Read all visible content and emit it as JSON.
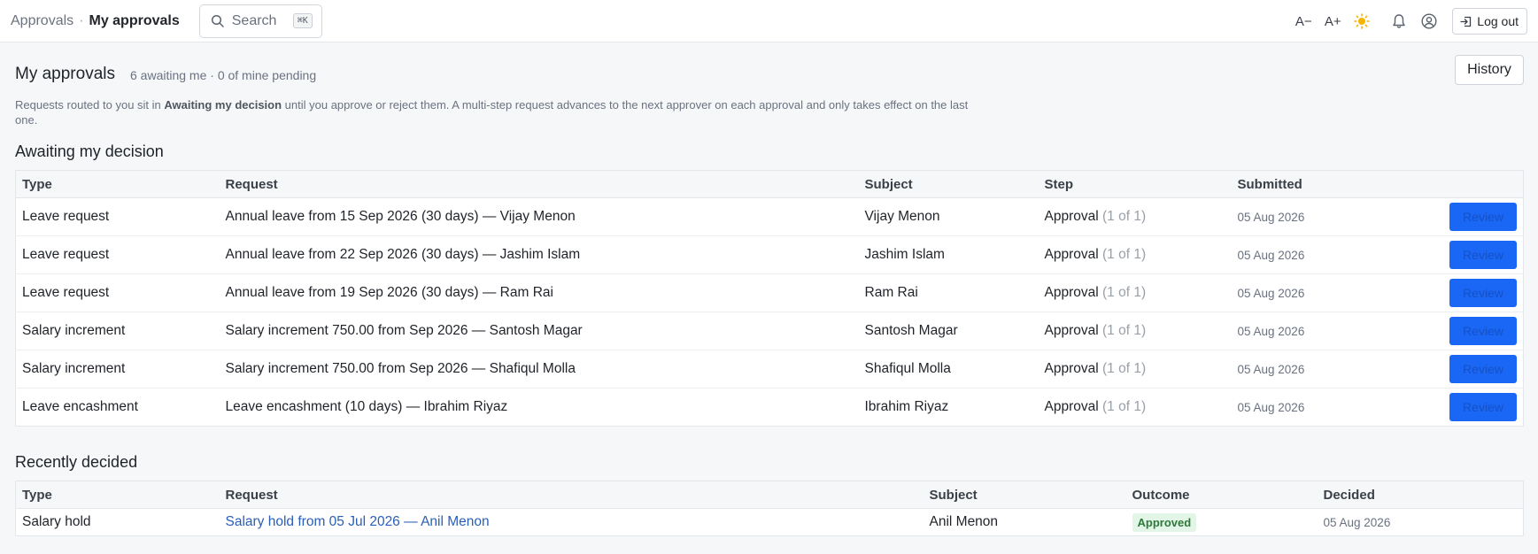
{
  "breadcrumb": {
    "parent": "Approvals",
    "separator": "·",
    "current": "My approvals"
  },
  "search": {
    "label": "Search",
    "shortcut": "⌘K"
  },
  "toolbar": {
    "font_decrease": "A−",
    "font_increase": "A+",
    "logout_label": "Log out"
  },
  "page": {
    "title": "My approvals",
    "subtitle": "6 awaiting me · 0 of mine pending",
    "history_label": "History",
    "desc_before": "Requests routed to you sit in ",
    "desc_bold": "Awaiting my decision",
    "desc_after": " until you approve or reject them. A multi-step request advances to the next approver on each approval and only takes effect on the last one."
  },
  "awaiting": {
    "title": "Awaiting my decision",
    "columns": [
      "Type",
      "Request",
      "Subject",
      "Step",
      "Submitted"
    ],
    "review_label": "Review",
    "rows": [
      {
        "type": "Leave request",
        "request": "Annual leave from 15 Sep 2026 (30 days) — Vijay Menon",
        "subject": "Vijay Menon",
        "step": "Approval",
        "step_count": "(1 of 1)",
        "submitted": "05 Aug 2026"
      },
      {
        "type": "Leave request",
        "request": "Annual leave from 22 Sep 2026 (30 days) — Jashim Islam",
        "subject": "Jashim Islam",
        "step": "Approval",
        "step_count": "(1 of 1)",
        "submitted": "05 Aug 2026"
      },
      {
        "type": "Leave request",
        "request": "Annual leave from 19 Sep 2026 (30 days) — Ram Rai",
        "subject": "Ram Rai",
        "step": "Approval",
        "step_count": "(1 of 1)",
        "submitted": "05 Aug 2026"
      },
      {
        "type": "Salary increment",
        "request": "Salary increment 750.00 from Sep 2026 — Santosh Magar",
        "subject": "Santosh Magar",
        "step": "Approval",
        "step_count": "(1 of 1)",
        "submitted": "05 Aug 2026"
      },
      {
        "type": "Salary increment",
        "request": "Salary increment 750.00 from Sep 2026 — Shafiqul Molla",
        "subject": "Shafiqul Molla",
        "step": "Approval",
        "step_count": "(1 of 1)",
        "submitted": "05 Aug 2026"
      },
      {
        "type": "Leave encashment",
        "request": "Leave encashment (10 days) — Ibrahim Riyaz",
        "subject": "Ibrahim Riyaz",
        "step": "Approval",
        "step_count": "(1 of 1)",
        "submitted": "05 Aug 2026"
      }
    ]
  },
  "decided": {
    "title": "Recently decided",
    "columns": [
      "Type",
      "Request",
      "Subject",
      "Outcome",
      "Decided"
    ],
    "rows": [
      {
        "type": "Salary hold",
        "request": "Salary hold from 05 Jul 2026 — Anil Menon",
        "subject": "Anil Menon",
        "outcome": "Approved",
        "decided": "05 Aug 2026"
      }
    ]
  },
  "colors": {
    "accent": "#1a66f5",
    "link": "#2a5fb8",
    "success_bg": "#e3f5e6",
    "success_text": "#2d7a3c"
  }
}
